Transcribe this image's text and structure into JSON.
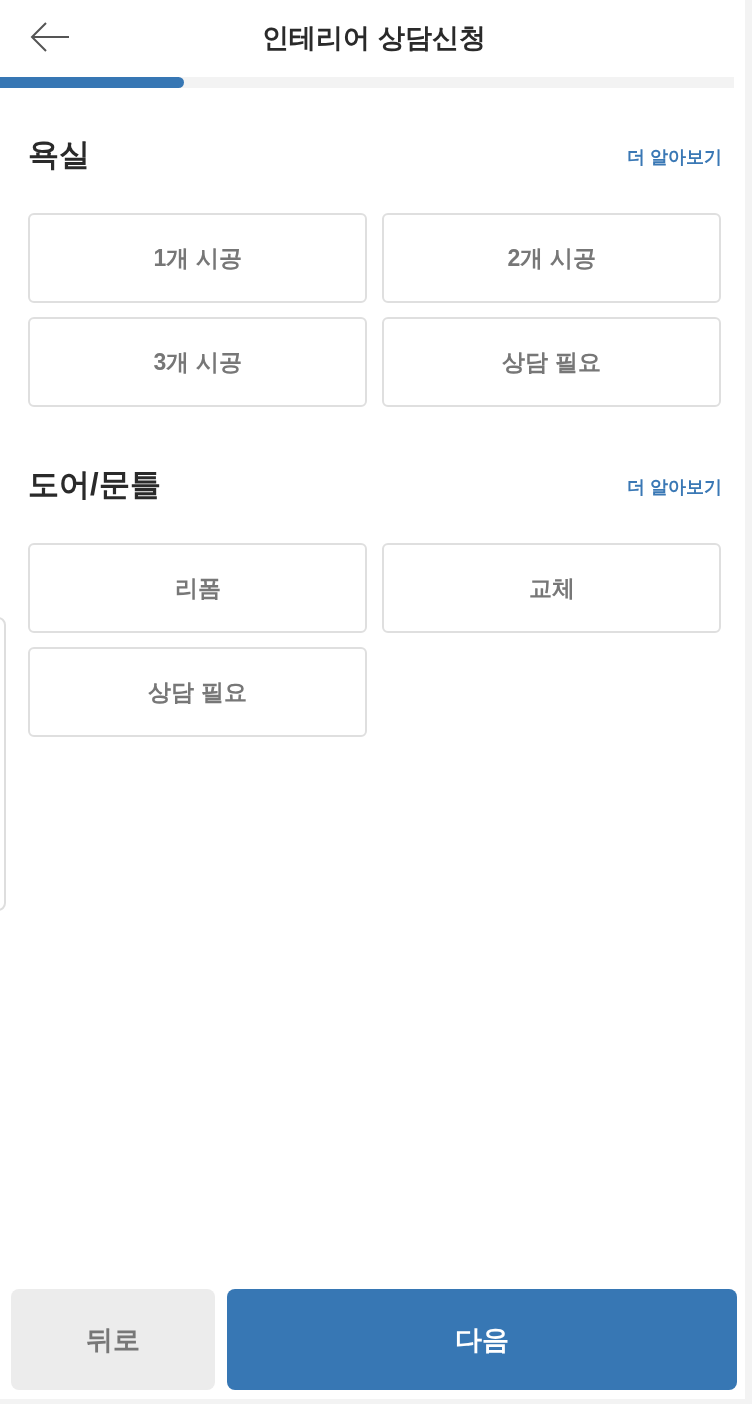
{
  "header": {
    "title": "인테리어 상담신청"
  },
  "progress": {
    "level": 0.25
  },
  "sections": [
    {
      "title": "욕실",
      "link": "더 알아보기",
      "options": [
        {
          "label": "1개 시공",
          "selected": false
        },
        {
          "label": "2개 시공",
          "selected": false
        },
        {
          "label": "3개 시공",
          "selected": false
        },
        {
          "label": "상담 필요",
          "selected": false
        }
      ]
    },
    {
      "title": "도어/문틀",
      "link": "더 알아보기",
      "options": [
        {
          "label": "리폼",
          "selected": false
        },
        {
          "label": "교체",
          "selected": false
        },
        {
          "label": "상담 필요",
          "selected": false
        }
      ]
    }
  ],
  "footer": {
    "buttons": [
      {
        "label": "뒤로",
        "kind": "secondary"
      },
      {
        "label": "다음",
        "kind": "primary"
      }
    ]
  }
}
